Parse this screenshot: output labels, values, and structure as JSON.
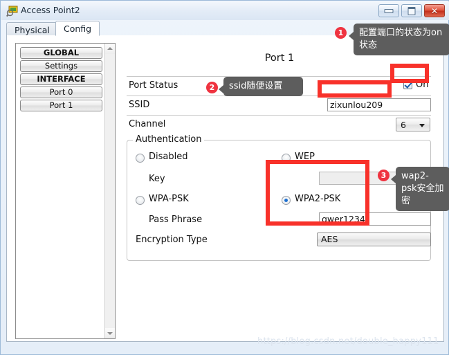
{
  "window": {
    "title": "Access Point2",
    "icon": "access-point-icon",
    "controls": {
      "minimize": "–",
      "maximize": "□",
      "close": "✕"
    }
  },
  "tabs": [
    {
      "label": "Physical",
      "active": false
    },
    {
      "label": "Config",
      "active": true
    }
  ],
  "sidebar": {
    "items": [
      {
        "label": "GLOBAL",
        "heading": true
      },
      {
        "label": "Settings",
        "heading": false
      },
      {
        "label": "INTERFACE",
        "heading": true
      },
      {
        "label": "Port 0",
        "heading": false
      },
      {
        "label": "Port 1",
        "heading": false
      }
    ]
  },
  "form": {
    "title": "Port 1",
    "port_status": {
      "label": "Port Status",
      "checkbox_label": "On",
      "checked": true
    },
    "ssid": {
      "label": "SSID",
      "value": "zixunlou209"
    },
    "channel": {
      "label": "Channel",
      "value": "6"
    },
    "authentication": {
      "legend": "Authentication",
      "options": [
        {
          "label": "Disabled",
          "selected": false
        },
        {
          "label": "WEP",
          "selected": false
        },
        {
          "label": "WPA-PSK",
          "selected": false
        },
        {
          "label": "WPA2-PSK",
          "selected": true
        }
      ],
      "key": {
        "label": "Key",
        "value": "",
        "enabled": false
      },
      "pass_phrase": {
        "label": "Pass Phrase",
        "value": "qwer1234"
      },
      "encryption_type": {
        "label": "Encryption Type",
        "value": "AES"
      }
    }
  },
  "annotations": [
    {
      "number": "1",
      "text": "配置端口的状态为on状态"
    },
    {
      "number": "2",
      "text": "ssid随便设置"
    },
    {
      "number": "3",
      "text": "wap2-psk安全加密"
    }
  ],
  "watermark": "https://blog.csdn.net/double_happy111",
  "colors": {
    "highlight": "#f8312a",
    "badge": "#ef3340",
    "callout_bg": "#5d5d5d"
  }
}
